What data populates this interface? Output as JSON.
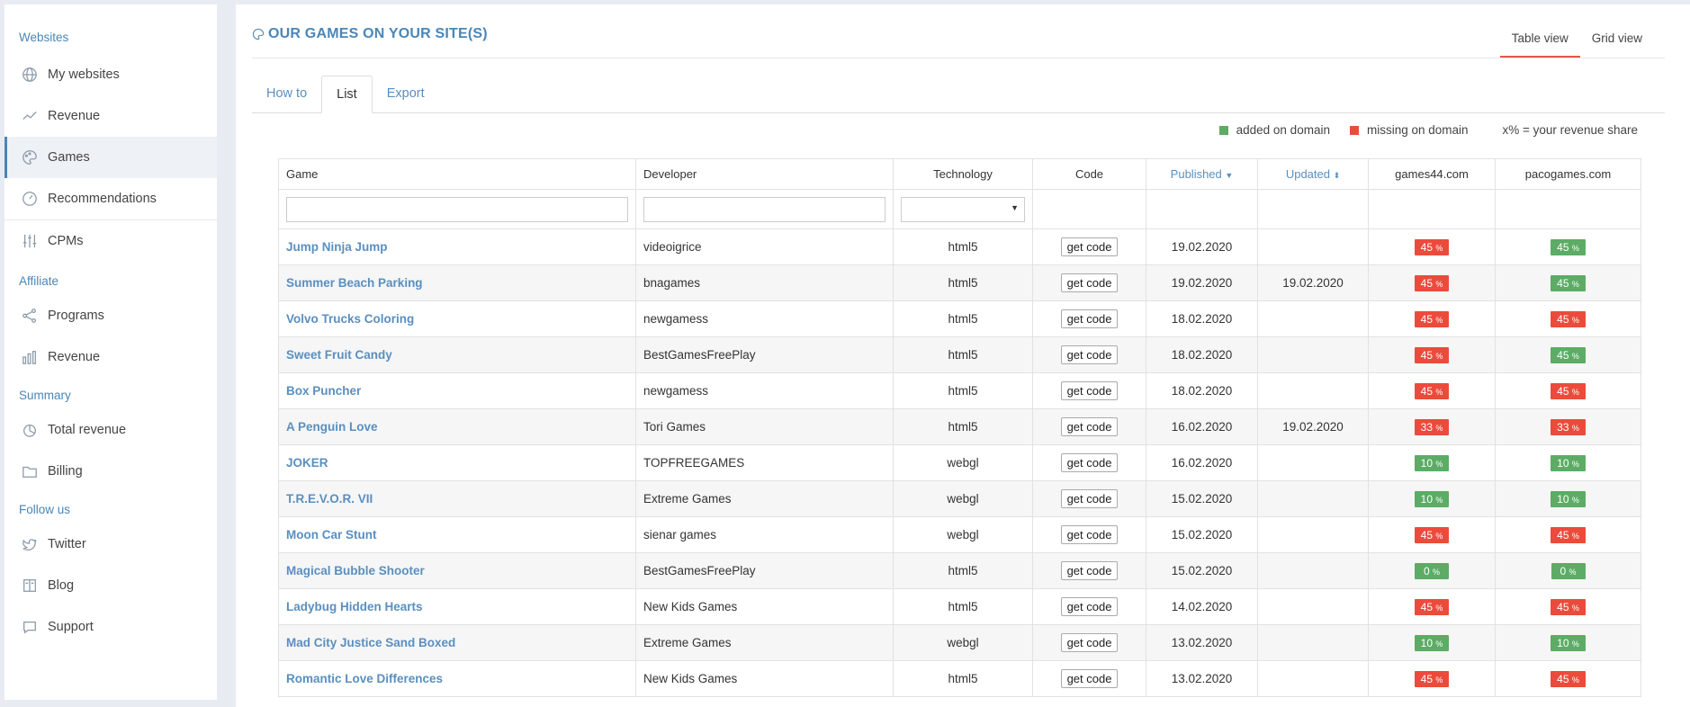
{
  "sidebar": {
    "sections": [
      {
        "label": "Websites",
        "items": [
          {
            "label": "My websites",
            "icon": "globe-icon"
          },
          {
            "label": "Revenue",
            "icon": "trend-line-icon"
          },
          {
            "label": "Games",
            "icon": "palette-icon",
            "active": true
          },
          {
            "label": "Recommendations",
            "icon": "gauge-icon"
          },
          {
            "label": "CPMs",
            "icon": "sliders-icon"
          }
        ]
      },
      {
        "label": "Affiliate",
        "items": [
          {
            "label": "Programs",
            "icon": "share-icon"
          },
          {
            "label": "Revenue",
            "icon": "bar-chart-icon"
          }
        ]
      },
      {
        "label": "Summary",
        "items": [
          {
            "label": "Total revenue",
            "icon": "pie-chart-icon"
          },
          {
            "label": "Billing",
            "icon": "folder-icon"
          }
        ]
      },
      {
        "label": "Follow us",
        "items": [
          {
            "label": "Twitter",
            "icon": "twitter-icon"
          },
          {
            "label": "Blog",
            "icon": "book-icon"
          },
          {
            "label": "Support",
            "icon": "chat-icon"
          }
        ]
      }
    ]
  },
  "header": {
    "title": "OUR GAMES ON YOUR SITE(S)",
    "view_tabs": [
      "Table view",
      "Grid view"
    ],
    "active_view": "Table view"
  },
  "tabs": [
    "How to",
    "List",
    "Export"
  ],
  "active_tab": "List",
  "legend": {
    "added": "added on domain",
    "missing": "missing on domain",
    "share": "x% = your revenue share",
    "added_color": "#5cac65",
    "missing_color": "#ec4b3c"
  },
  "table": {
    "headers": [
      "Game",
      "Developer",
      "Technology",
      "Code",
      "Published",
      "Updated",
      "games44.com",
      "pacogames.com"
    ],
    "code_label": "get code",
    "rows": [
      {
        "game": "Jump Ninja Jump",
        "developer": "videoigrice",
        "tech": "html5",
        "published": "19.02.2020",
        "updated": "",
        "d1": "45",
        "d1s": "red",
        "d2": "45",
        "d2s": "green"
      },
      {
        "game": "Summer Beach Parking",
        "developer": "bnagames",
        "tech": "html5",
        "published": "19.02.2020",
        "updated": "19.02.2020",
        "d1": "45",
        "d1s": "red",
        "d2": "45",
        "d2s": "green"
      },
      {
        "game": "Volvo Trucks Coloring",
        "developer": "newgamess",
        "tech": "html5",
        "published": "18.02.2020",
        "updated": "",
        "d1": "45",
        "d1s": "red",
        "d2": "45",
        "d2s": "red"
      },
      {
        "game": "Sweet Fruit Candy",
        "developer": "BestGamesFreePlay",
        "tech": "html5",
        "published": "18.02.2020",
        "updated": "",
        "d1": "45",
        "d1s": "red",
        "d2": "45",
        "d2s": "green"
      },
      {
        "game": "Box Puncher",
        "developer": "newgamess",
        "tech": "html5",
        "published": "18.02.2020",
        "updated": "",
        "d1": "45",
        "d1s": "red",
        "d2": "45",
        "d2s": "red"
      },
      {
        "game": "A Penguin Love",
        "developer": "Tori Games",
        "tech": "html5",
        "published": "16.02.2020",
        "updated": "19.02.2020",
        "d1": "33",
        "d1s": "red",
        "d2": "33",
        "d2s": "red"
      },
      {
        "game": "JOKER",
        "developer": "TOPFREEGAMES",
        "tech": "webgl",
        "published": "16.02.2020",
        "updated": "",
        "d1": "10",
        "d1s": "green",
        "d2": "10",
        "d2s": "green"
      },
      {
        "game": "T.R.E.V.O.R. VII",
        "developer": "Extreme Games",
        "tech": "webgl",
        "published": "15.02.2020",
        "updated": "",
        "d1": "10",
        "d1s": "green",
        "d2": "10",
        "d2s": "green"
      },
      {
        "game": "Moon Car Stunt",
        "developer": "sienar games",
        "tech": "webgl",
        "published": "15.02.2020",
        "updated": "",
        "d1": "45",
        "d1s": "red",
        "d2": "45",
        "d2s": "red"
      },
      {
        "game": "Magical Bubble Shooter",
        "developer": "BestGamesFreePlay",
        "tech": "html5",
        "published": "15.02.2020",
        "updated": "",
        "d1": "0",
        "d1s": "green",
        "d2": "0",
        "d2s": "green"
      },
      {
        "game": "Ladybug Hidden Hearts",
        "developer": "New Kids Games",
        "tech": "html5",
        "published": "14.02.2020",
        "updated": "",
        "d1": "45",
        "d1s": "red",
        "d2": "45",
        "d2s": "red"
      },
      {
        "game": "Mad City Justice Sand Boxed",
        "developer": "Extreme Games",
        "tech": "webgl",
        "published": "13.02.2020",
        "updated": "",
        "d1": "10",
        "d1s": "green",
        "d2": "10",
        "d2s": "green"
      },
      {
        "game": "Romantic Love Differences",
        "developer": "New Kids Games",
        "tech": "html5",
        "published": "13.02.2020",
        "updated": "",
        "d1": "45",
        "d1s": "red",
        "d2": "45",
        "d2s": "red"
      }
    ]
  }
}
